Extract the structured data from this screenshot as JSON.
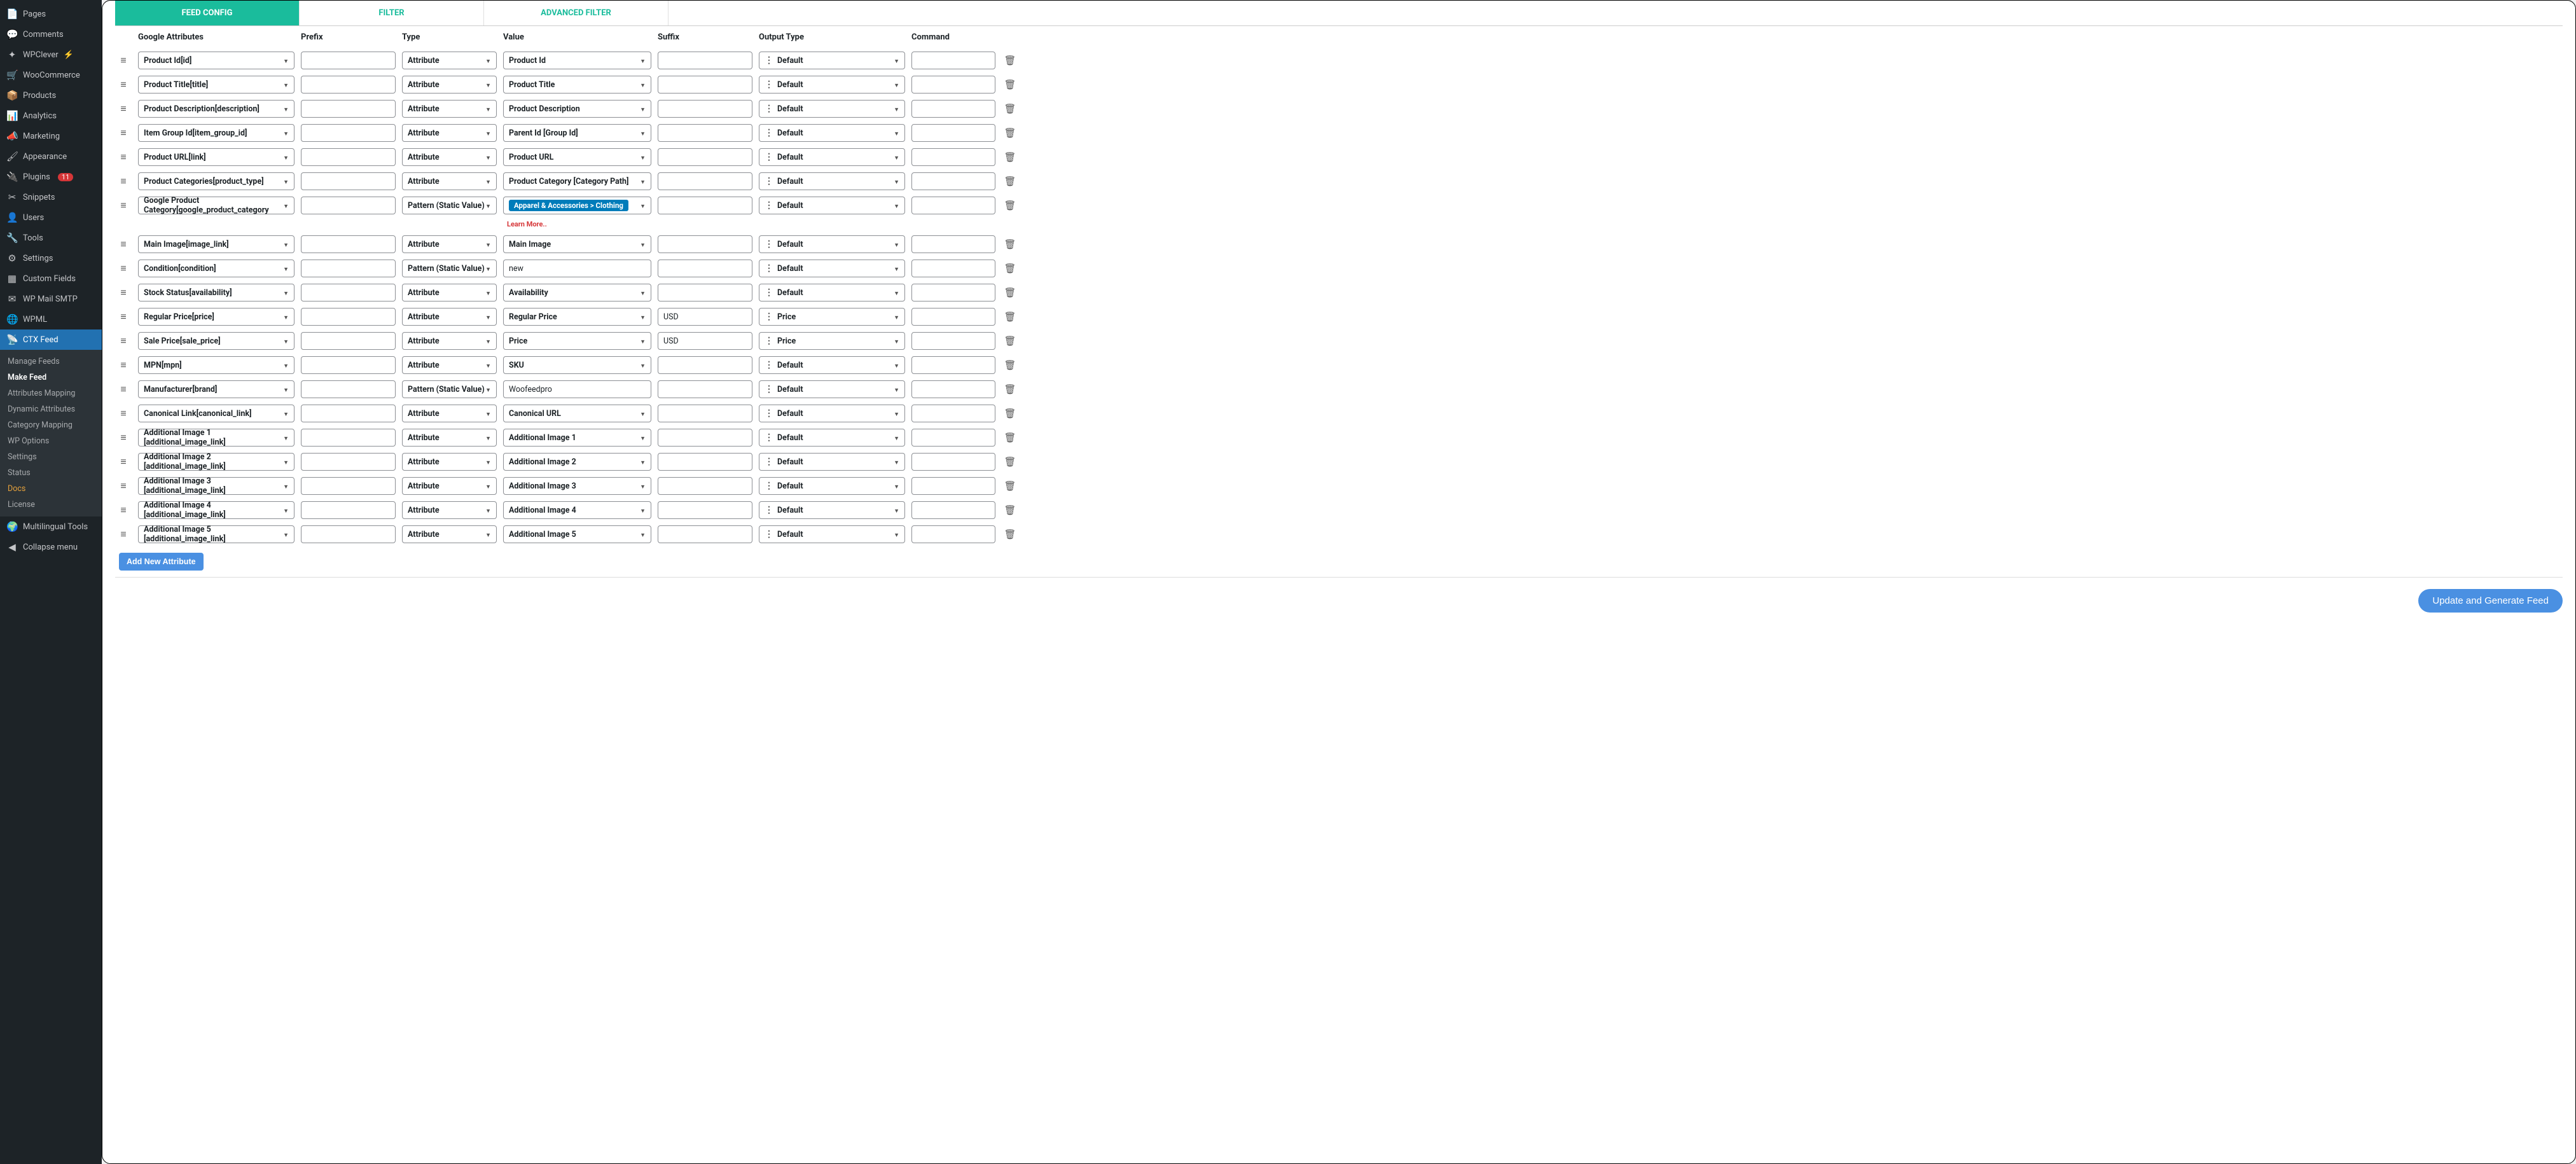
{
  "sidebar": {
    "items": [
      {
        "icon": "📄",
        "label": "Pages"
      },
      {
        "icon": "💬",
        "label": "Comments"
      },
      {
        "icon": "✦",
        "label": "WPClever",
        "bolt": true
      },
      {
        "icon": "🛒",
        "label": "WooCommerce"
      },
      {
        "icon": "📦",
        "label": "Products"
      },
      {
        "icon": "📊",
        "label": "Analytics"
      },
      {
        "icon": "📣",
        "label": "Marketing"
      },
      {
        "icon": "🖌",
        "label": "Appearance"
      },
      {
        "icon": "🔌",
        "label": "Plugins",
        "badge": "11"
      },
      {
        "icon": "✂",
        "label": "Snippets"
      },
      {
        "icon": "👤",
        "label": "Users"
      },
      {
        "icon": "🔧",
        "label": "Tools"
      },
      {
        "icon": "⚙",
        "label": "Settings"
      },
      {
        "icon": "▦",
        "label": "Custom Fields"
      },
      {
        "icon": "✉",
        "label": "WP Mail SMTP"
      },
      {
        "icon": "🌐",
        "label": "WPML"
      },
      {
        "icon": "📡",
        "label": "CTX Feed",
        "active": true
      },
      {
        "icon": "🌍",
        "label": "Multilingual Tools"
      },
      {
        "icon": "◀",
        "label": "Collapse menu"
      }
    ],
    "submenu": [
      "Manage Feeds",
      "Make Feed",
      "Attributes Mapping",
      "Dynamic Attributes",
      "Category Mapping",
      "WP Options",
      "Settings",
      "Status",
      "Docs",
      "License"
    ],
    "submenu_current": "Make Feed",
    "submenu_docs": "Docs"
  },
  "tabs": [
    "FEED CONFIG",
    "FILTER",
    "ADVANCED FILTER"
  ],
  "headers": {
    "google_attributes": "Google Attributes",
    "prefix": "Prefix",
    "type": "Type",
    "value": "Value",
    "suffix": "Suffix",
    "output_type": "Output Type",
    "command": "Command"
  },
  "learn_more": "Learn More..",
  "rows": [
    {
      "attr": "Product Id[id]",
      "type": "Attribute",
      "value": "Product Id",
      "suffix": "",
      "output": "Default"
    },
    {
      "attr": "Product Title[title]",
      "type": "Attribute",
      "value": "Product Title",
      "suffix": "",
      "output": "Default"
    },
    {
      "attr": "Product Description[description]",
      "type": "Attribute",
      "value": "Product Description",
      "suffix": "",
      "output": "Default"
    },
    {
      "attr": "Item Group Id[item_group_id]",
      "type": "Attribute",
      "value": "Parent Id [Group Id]",
      "suffix": "",
      "output": "Default"
    },
    {
      "attr": "Product URL[link]",
      "type": "Attribute",
      "value": "Product URL",
      "suffix": "",
      "output": "Default"
    },
    {
      "attr": "Product Categories[product_type]",
      "type": "Attribute",
      "value": "Product Category [Category Path]",
      "suffix": "",
      "output": "Default"
    },
    {
      "attr": "Google Product Category[google_product_category",
      "type": "Pattern (Static Value)",
      "value_pill": "Apparel & Accessories > Clothing",
      "suffix": "",
      "output": "Default",
      "learn": true
    },
    {
      "attr": "Main Image[image_link]",
      "type": "Attribute",
      "value": "Main Image",
      "suffix": "",
      "output": "Default"
    },
    {
      "attr": "Condition[condition]",
      "type": "Pattern (Static Value)",
      "value_text": "new",
      "suffix": "",
      "output": "Default"
    },
    {
      "attr": "Stock Status[availability]",
      "type": "Attribute",
      "value": "Availability",
      "suffix": "",
      "output": "Default"
    },
    {
      "attr": "Regular Price[price]",
      "type": "Attribute",
      "value": "Regular Price",
      "suffix": "USD",
      "output": "Price"
    },
    {
      "attr": "Sale Price[sale_price]",
      "type": "Attribute",
      "value": "Price",
      "suffix": "USD",
      "output": "Price"
    },
    {
      "attr": "MPN[mpn]",
      "type": "Attribute",
      "value": "SKU",
      "suffix": "",
      "output": "Default"
    },
    {
      "attr": "Manufacturer[brand]",
      "type": "Pattern (Static Value)",
      "value_text": "Woofeedpro",
      "suffix": "",
      "output": "Default"
    },
    {
      "attr": "Canonical Link[canonical_link]",
      "type": "Attribute",
      "value": "Canonical URL",
      "suffix": "",
      "output": "Default"
    },
    {
      "attr": "Additional Image 1 [additional_image_link]",
      "type": "Attribute",
      "value": "Additional Image 1",
      "suffix": "",
      "output": "Default"
    },
    {
      "attr": "Additional Image 2 [additional_image_link]",
      "type": "Attribute",
      "value": "Additional Image 2",
      "suffix": "",
      "output": "Default"
    },
    {
      "attr": "Additional Image 3 [additional_image_link]",
      "type": "Attribute",
      "value": "Additional Image 3",
      "suffix": "",
      "output": "Default"
    },
    {
      "attr": "Additional Image 4 [additional_image_link]",
      "type": "Attribute",
      "value": "Additional Image 4",
      "suffix": "",
      "output": "Default"
    },
    {
      "attr": "Additional Image 5 [additional_image_link]",
      "type": "Attribute",
      "value": "Additional Image 5",
      "suffix": "",
      "output": "Default"
    }
  ],
  "buttons": {
    "add_new": "Add New Attribute",
    "generate": "Update and Generate Feed"
  }
}
